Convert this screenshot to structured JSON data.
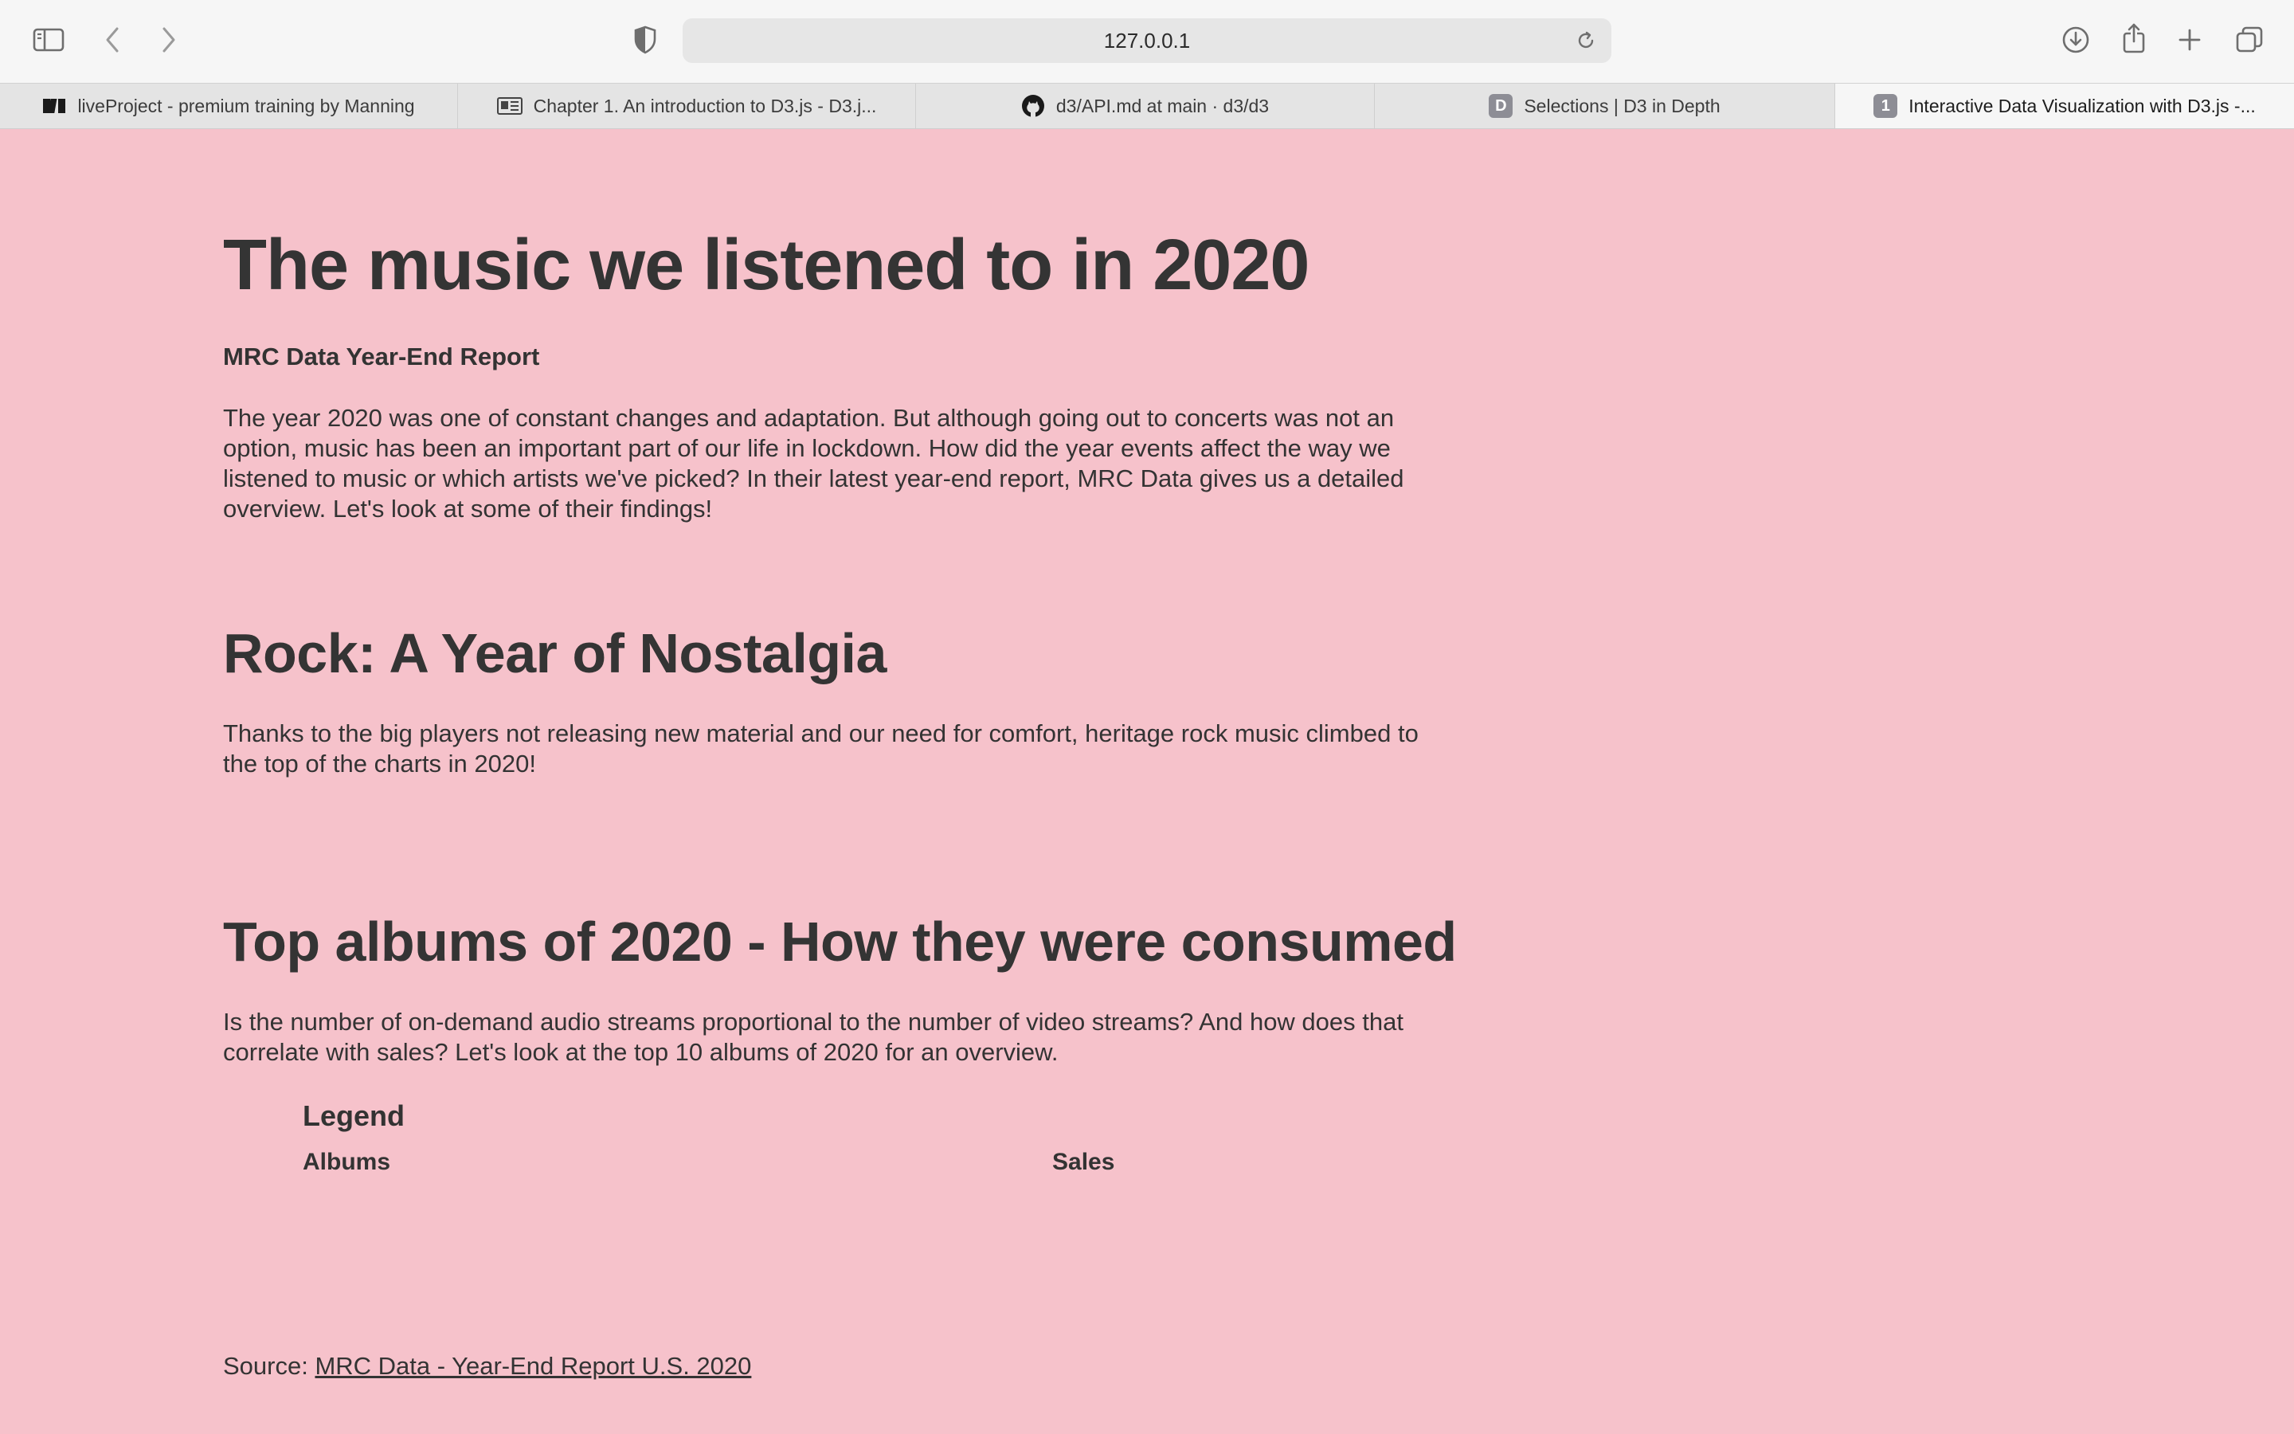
{
  "browser": {
    "url": "127.0.0.1",
    "tabs": [
      {
        "title": "liveProject - premium training by Manning",
        "icon": "manning-logo-icon",
        "active": false
      },
      {
        "title": "Chapter 1. An introduction to D3.js - D3.j...",
        "icon": "book-page-icon",
        "active": false
      },
      {
        "title": "d3/API.md at main · d3/d3",
        "icon": "github-icon",
        "active": false
      },
      {
        "title": "Selections | D3 in Depth",
        "icon": "d-badge-icon",
        "badge": "D",
        "active": false
      },
      {
        "title": "Interactive Data Visualization with D3.js -...",
        "icon": "number-badge-icon",
        "badge": "1",
        "active": true
      }
    ]
  },
  "page": {
    "title": "The music we listened to in 2020",
    "subtitle": "MRC Data Year-End Report",
    "intro": "The year 2020 was one of constant changes and adaptation. But although going out to concerts was not an option, music has been an important part of our life in lockdown. How did the year events affect the way we listened to music or which artists we've picked? In their latest year-end report, MRC Data gives us a detailed overview. Let's look at some of their findings!",
    "section_rock": {
      "heading": "Rock: A Year of Nostalgia",
      "text": "Thanks to the big players not releasing new material and our need for comfort, heritage rock music climbed to the top of the charts in 2020!"
    },
    "section_albums": {
      "heading": "Top albums of 2020 - How they were consumed",
      "text": "Is the number of on-demand audio streams proportional to the number of video streams? And how does that correlate with sales? Let's look at the top 10 albums of 2020 for an overview."
    },
    "legend": {
      "title": "Legend",
      "albums_label": "Albums",
      "sales_label": "Sales"
    },
    "source": {
      "prefix": "Source: ",
      "link_text": "MRC Data - Year-End Report U.S. 2020"
    }
  },
  "colors": {
    "background": "#f6c2cb",
    "text": "#333333"
  }
}
